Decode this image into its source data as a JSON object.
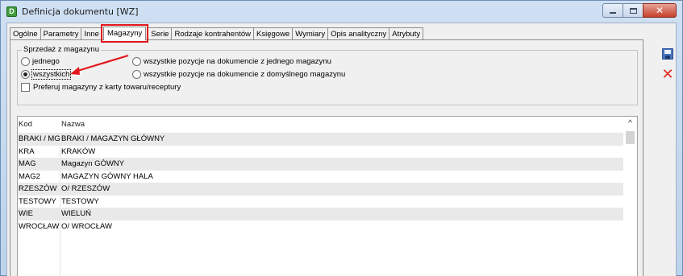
{
  "window": {
    "title": "Definicja dokumentu [WZ]",
    "icon": "document-d-icon",
    "buttons": {
      "close_glyph": "✕"
    }
  },
  "tabs": [
    {
      "label": "Ogólne"
    },
    {
      "label": "Parametry"
    },
    {
      "label": "Inne"
    },
    {
      "label": "Magazyny",
      "active": true
    },
    {
      "label": "Serie"
    },
    {
      "label": "Rodzaje kontrahentów"
    },
    {
      "label": "Księgowe"
    },
    {
      "label": "Wymiary"
    },
    {
      "label": "Opis analityczny"
    },
    {
      "label": "Atrybuty"
    }
  ],
  "sales_group": {
    "legend": "Sprzedaż z magazynu",
    "radio_one": "jednego",
    "radio_all": "wszystkich",
    "radio_all_positions_one": "wszystkie pozycje na dokumencie z jednego magazynu",
    "radio_all_positions_default": "wszystkie pozycje na dokumencie z domyślnego magazynu",
    "prefer_checkbox": "Preferuj magazyny z karty towaru/receptury",
    "selected": "wszystkich"
  },
  "list": {
    "columns": [
      "Kod",
      "Nazwa"
    ],
    "rows": [
      {
        "kod": "BRAKI / MG",
        "nazwa": "BRAKI / MAGAZYN GŁÓWNY"
      },
      {
        "kod": "KRA",
        "nazwa": "KRAKÓW"
      },
      {
        "kod": "MAG",
        "nazwa": "Magazyn GÓWNY"
      },
      {
        "kod": "MAG2",
        "nazwa": "MAGAZYN GÓWNY HALA"
      },
      {
        "kod": "RZESZÓW",
        "nazwa": "O/ RZESZÓW"
      },
      {
        "kod": "TESTOWY",
        "nazwa": "TESTOWY"
      },
      {
        "kod": "WIE",
        "nazwa": "WIELUŃ"
      },
      {
        "kod": "WROCŁAW",
        "nazwa": "O/ WROCŁAW"
      }
    ]
  },
  "toolbar": {
    "save_icon": "save-icon",
    "cancel_icon": "cancel-icon",
    "cancel_glyph": "✕"
  },
  "colors": {
    "highlight_red": "#e3161b",
    "alt_row": "#e9e9e9"
  }
}
